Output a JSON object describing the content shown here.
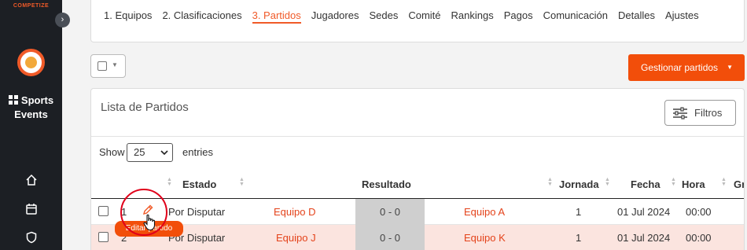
{
  "sidebar": {
    "brand": "COMPETIZE",
    "app_name_line1": "Sports",
    "app_name_line2": "Events",
    "collapse_glyph": "›",
    "icons": [
      "home-icon",
      "calendar-icon",
      "shield-icon"
    ]
  },
  "tabs": [
    {
      "label": "1. Equipos",
      "active": false
    },
    {
      "label": "2. Clasificaciones",
      "active": false
    },
    {
      "label": "3. Partidos",
      "active": true
    },
    {
      "label": "Jugadores",
      "active": false
    },
    {
      "label": "Sedes",
      "active": false
    },
    {
      "label": "Comité",
      "active": false
    },
    {
      "label": "Rankings",
      "active": false
    },
    {
      "label": "Pagos",
      "active": false
    },
    {
      "label": "Comunicación",
      "active": false
    },
    {
      "label": "Detalles",
      "active": false
    },
    {
      "label": "Ajustes",
      "active": false
    }
  ],
  "toolbar": {
    "manage_label": "Gestionar partidos",
    "caret": "▼"
  },
  "list": {
    "title": "Lista de Partidos",
    "filters_label": "Filtros",
    "show_label": "Show",
    "entries_value": "25",
    "entries_label": "entries"
  },
  "table": {
    "headers": {
      "estado": "Estado",
      "resultado": "Resultado",
      "jornada": "Jornada",
      "fecha": "Fecha",
      "hora": "Hora",
      "extra": "Gr"
    },
    "rows": [
      {
        "num": "1",
        "estado": "Por Disputar",
        "local": "Equipo D",
        "resultado": "0 - 0",
        "visitante": "Equipo A",
        "jornada": "1",
        "fecha": "01 Jul 2024",
        "hora": "00:00"
      },
      {
        "num": "2",
        "estado": "Por Disputar",
        "local": "Equipo J",
        "resultado": "0 - 0",
        "visitante": "Equipo K",
        "jornada": "1",
        "fecha": "01 Jul 2024",
        "hora": "00:00"
      }
    ]
  },
  "tooltip": "Editar partido",
  "colors": {
    "accent": "#f24e0a",
    "sidebar": "#1c1f24",
    "highlight": "#e0001a",
    "row_selected": "#fbe4df"
  }
}
